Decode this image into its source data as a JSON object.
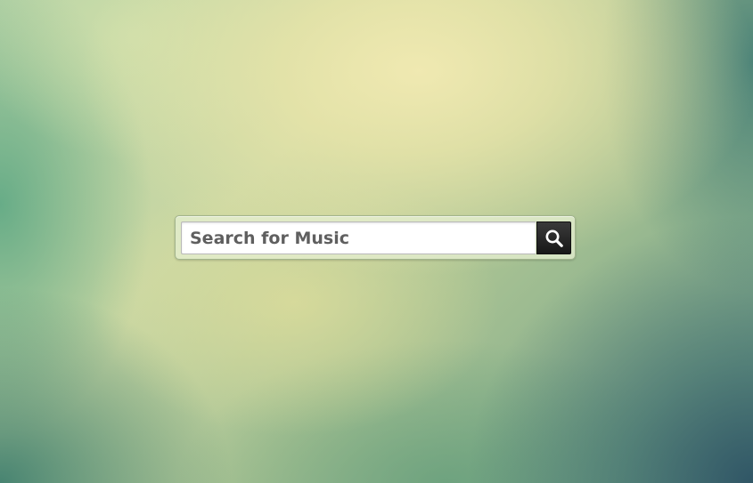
{
  "background": {
    "colors": [
      "#ece6aa",
      "#8fba8f",
      "#2d5264",
      "#58a582"
    ]
  },
  "search": {
    "placeholder": "Search for Music",
    "button_icon": "search-icon",
    "button_color": "#222222"
  }
}
